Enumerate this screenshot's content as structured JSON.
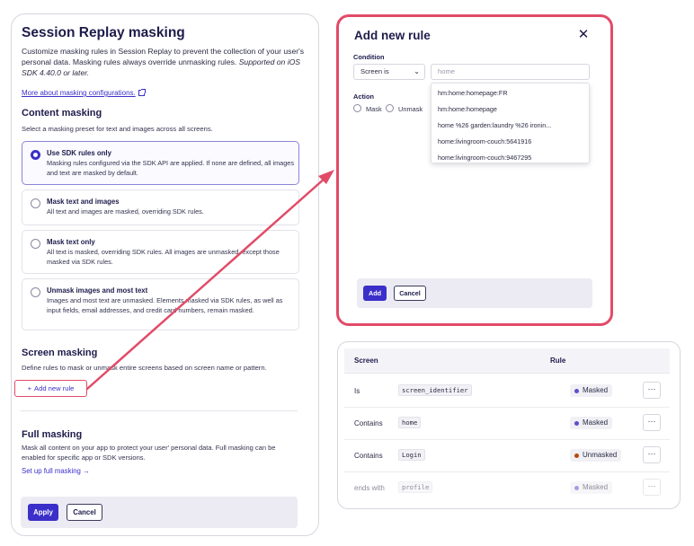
{
  "left": {
    "title": "Session Replay masking",
    "desc_main": "Customize masking rules in Session Replay to prevent the collection of your user's personal data. Masking rules always override unmasking rules.",
    "desc_italic": "Supported on iOS SDK 4.40.0 or later.",
    "more_link": "More about masking configurations.",
    "content_masking": {
      "title": "Content masking",
      "subtitle": "Select a masking preset for text and images across all screens.",
      "options": [
        {
          "title": "Use SDK rules only",
          "desc": "Masking rules configured via the SDK API are applied. If none are defined, all images and text are masked by default."
        },
        {
          "title": "Mask text and images",
          "desc": "All text and images are masked, overriding SDK rules."
        },
        {
          "title": "Mask text only",
          "desc": "All text is masked, overriding SDK rules. All images are unmasked, except those masked via SDK rules."
        },
        {
          "title": "Unmask images and most text",
          "desc": "Images and most text are unmasked. Elements masked via SDK rules, as well as input fields, email addresses, and credit card numbers, remain masked."
        }
      ]
    },
    "screen_masking": {
      "title": "Screen masking",
      "subtitle": "Define rules to mask or unmask entire screens based on screen name or pattern.",
      "add_rule": "Add new rule"
    },
    "full_masking": {
      "title": "Full masking",
      "desc": "Mask all content on your app to protect your user' personal data. Full masking can be enabled for specific app or SDK versions.",
      "link": "Set up full masking →"
    },
    "footer": {
      "apply": "Apply",
      "cancel": "Cancel"
    }
  },
  "modal": {
    "title": "Add new rule",
    "close": "✕",
    "condition_label": "Condition",
    "condition_value": "Screen is",
    "input_placeholder": "home",
    "action_label": "Action",
    "actions": [
      "Mask",
      "Unmask"
    ],
    "suggestions": [
      "hm:home:homepage:FR",
      "hm:home:homepage",
      "home %26 garden:laundry %26 ironin...",
      "home:livingroom-couch:5641916",
      "home:livingroom-couch:9467295"
    ],
    "add": "Add",
    "cancel": "Cancel"
  },
  "table": {
    "headers": {
      "screen": "Screen",
      "rule": "Rule"
    },
    "rows": [
      {
        "condition": "Is",
        "value": "screen_identifier",
        "rule": "Masked",
        "dot": "#5b4fd1"
      },
      {
        "condition": "Contains",
        "value": "home",
        "rule": "Masked",
        "dot": "#5b4fd1"
      },
      {
        "condition": "Contains",
        "value": "Login",
        "rule": "Unmasked",
        "dot": "#b8480f"
      },
      {
        "condition": "ends with",
        "value": "profile",
        "rule": "Masked",
        "dot": "#5b4fd1"
      }
    ],
    "more": "···"
  },
  "colors": {
    "accent": "#3b2fc9",
    "highlight": "#e14b68"
  }
}
